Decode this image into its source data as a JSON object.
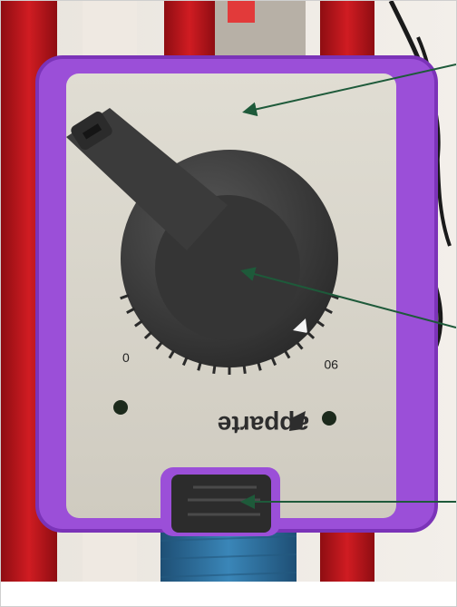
{
  "device": {
    "brand": "apparte",
    "scale_min": "0",
    "scale_max": "90",
    "colors": {
      "housing": "#9b4fd8",
      "faceplate": "#d9d6cc",
      "knob": "#3d3d3d",
      "pipe_red": "#c4161c",
      "pipe_blue": "#2f6f9c",
      "arrow": "#1e5a3a",
      "led": "#1c2a1c"
    }
  },
  "annotations": [
    {
      "target": "faceplate"
    },
    {
      "target": "knob"
    },
    {
      "target": "connector"
    }
  ]
}
